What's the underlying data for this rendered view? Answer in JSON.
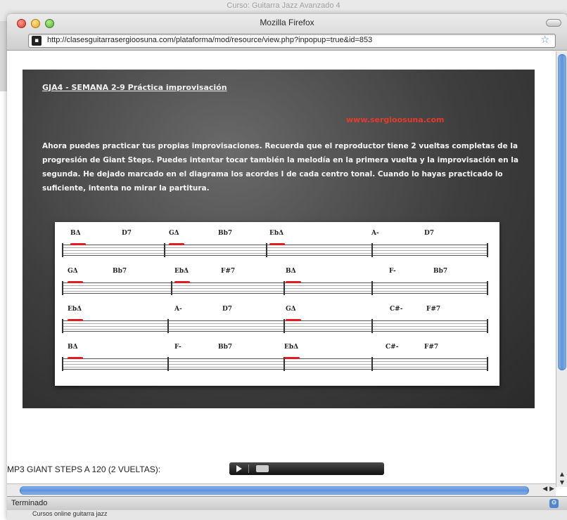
{
  "background_window": {
    "title": "Curso: Guitarra Jazz Avanzado 4"
  },
  "window": {
    "title": "Mozilla Firefox"
  },
  "address_bar": {
    "url": "http://clasesguitarrasergioosuna.com/plataforma/mod/resource/view.php?inpopup=true&id=853"
  },
  "panel": {
    "title": "GJA4 - SEMANA 2-9 Práctica improvisación",
    "website": "www.sergioosuna.com",
    "body": "Ahora puedes practicar tus propias improvisaciones. Recuerda que el reproductor tiene 2 vueltas completas de la progresión de Giant Steps. Puedes intentar tocar también la melodía en la primera vuelta y la improvisación en la segunda. He dejado marcado en el diagrama los acordes I de cada centro tonal. Cuando lo hayas practicado lo suficiente, intenta no mirar la partitura."
  },
  "chart_rows": [
    {
      "chords": [
        "BΔ",
        "D7",
        "GΔ",
        "Bb7",
        "EbΔ",
        "A-",
        "D7"
      ]
    },
    {
      "chords": [
        "GΔ",
        "Bb7",
        "EbΔ",
        "F#7",
        "BΔ",
        "F-",
        "Bb7"
      ]
    },
    {
      "chords": [
        "EbΔ",
        "A-",
        "D7",
        "GΔ",
        "C#-",
        "F#7"
      ]
    },
    {
      "chords": [
        "BΔ",
        "F-",
        "Bb7",
        "EbΔ",
        "C#-",
        "F#7"
      ]
    }
  ],
  "player": {
    "label": "MP3 GIANT STEPS A 120 (2 VUELTAS):"
  },
  "status": {
    "text": "Terminado"
  },
  "taskbar": {
    "item": "Cursos online guitarra jazz"
  },
  "colors": {
    "mark_red": "#e11b22",
    "link_red": "#e53a2b",
    "panel_dark": "#3e3e3e"
  }
}
